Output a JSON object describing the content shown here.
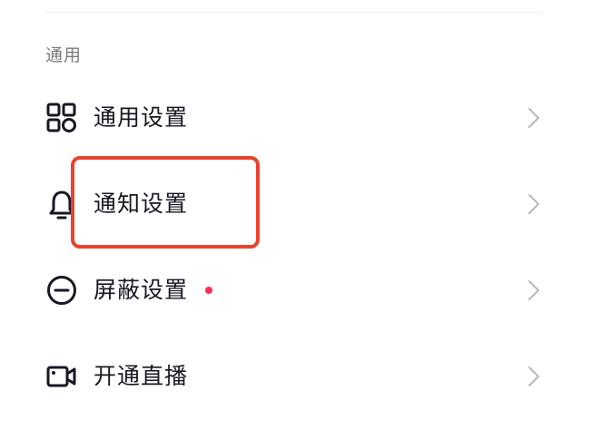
{
  "section": {
    "title": "通用"
  },
  "items": [
    {
      "label": "通用设置",
      "icon": "grid-icon",
      "has_dot": false
    },
    {
      "label": "通知设置",
      "icon": "bell-icon",
      "has_dot": false
    },
    {
      "label": "屏蔽设置",
      "icon": "block-icon",
      "has_dot": true
    },
    {
      "label": "开通直播",
      "icon": "video-camera-icon",
      "has_dot": false
    }
  ],
  "colors": {
    "text": "#161823",
    "section_title": "#7a7a80",
    "chevron": "#b8b8bc",
    "dot": "#fe2c55",
    "highlight": "#e8432f"
  }
}
